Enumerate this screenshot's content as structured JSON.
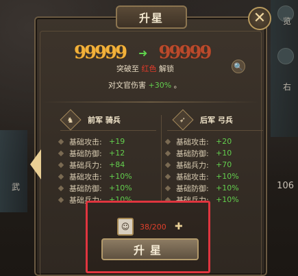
{
  "window": {
    "title": "升星"
  },
  "stars": {
    "current": [
      "9",
      "9",
      "9",
      "9",
      "9"
    ],
    "next": [
      "9",
      "9",
      "9",
      "9",
      "9"
    ],
    "current_color": "#f2b13a",
    "next_color": "#b94a2c",
    "arrow_icon": "right-arrow-icon"
  },
  "unlock": {
    "prefix": "突破至",
    "highlight": "红色",
    "suffix": "解锁"
  },
  "damage": {
    "prefix": "对文官伤害",
    "value": "+30%",
    "suffix": "。"
  },
  "columns": [
    {
      "title": "前军 骑兵",
      "icon": "horse-icon",
      "stats": [
        {
          "label": "基础攻击:",
          "value": "+19"
        },
        {
          "label": "基础防御:",
          "value": "+12"
        },
        {
          "label": "基础兵力:",
          "value": "+84"
        },
        {
          "label": "基础攻击:",
          "value": "+10%"
        },
        {
          "label": "基础防御:",
          "value": "+10%"
        },
        {
          "label": "基础兵力:",
          "value": "+10%"
        }
      ]
    },
    {
      "title": "后军 弓兵",
      "icon": "bow-icon",
      "stats": [
        {
          "label": "基础攻击:",
          "value": "+20"
        },
        {
          "label": "基础防御:",
          "value": "+10"
        },
        {
          "label": "基础兵力:",
          "value": "+70"
        },
        {
          "label": "基础攻击:",
          "value": "+10%"
        },
        {
          "label": "基础防御:",
          "value": "+10%"
        },
        {
          "label": "基础兵力:",
          "value": "+10%"
        }
      ]
    }
  ],
  "cost": {
    "current": "38",
    "max": "200"
  },
  "action": {
    "upgrade_label": "升星"
  },
  "side": {
    "left_char": "武",
    "right_char_1": "览",
    "right_char_2": "右",
    "right_num": "106"
  },
  "colors": {
    "highlight_red": "#e23b2a",
    "stat_green": "#63cf4e",
    "frame_gold": "#b89a5e"
  }
}
